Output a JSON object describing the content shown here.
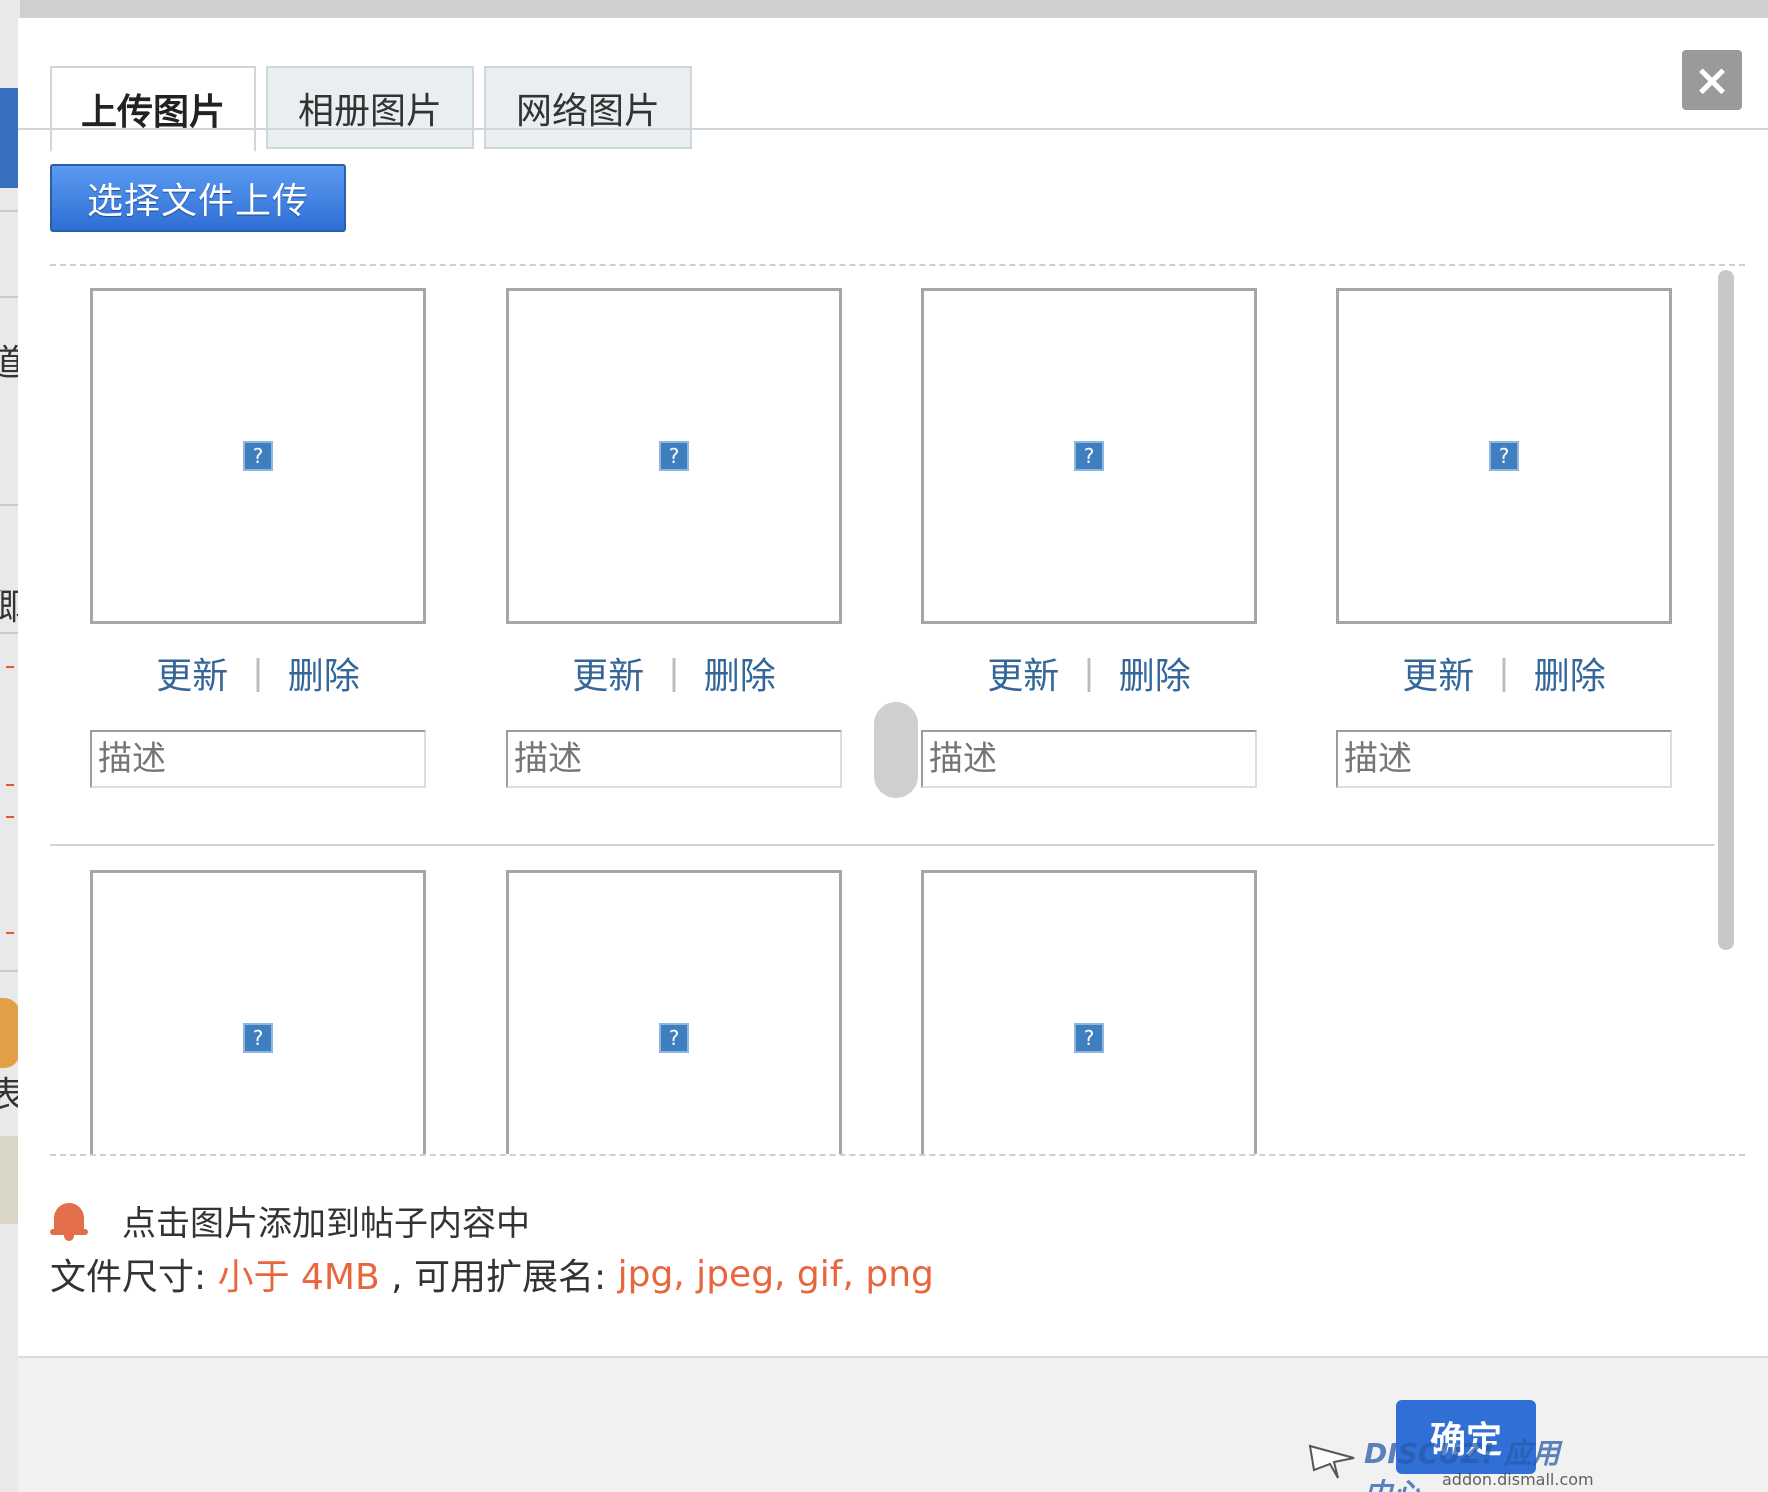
{
  "tabs": [
    {
      "label": "上传图片",
      "active": true
    },
    {
      "label": "相册图片",
      "active": false
    },
    {
      "label": "网络图片",
      "active": false
    }
  ],
  "close_icon": "×",
  "upload_button": "选择文件上传",
  "image_cells": [
    {
      "placeholder_icon": "?",
      "update": "更新",
      "delete": "删除",
      "separator": "|",
      "desc_placeholder": "描述"
    },
    {
      "placeholder_icon": "?",
      "update": "更新",
      "delete": "删除",
      "separator": "|",
      "desc_placeholder": "描述"
    },
    {
      "placeholder_icon": "?",
      "update": "更新",
      "delete": "删除",
      "separator": "|",
      "desc_placeholder": "描述"
    },
    {
      "placeholder_icon": "?",
      "update": "更新",
      "delete": "删除",
      "separator": "|",
      "desc_placeholder": "描述"
    },
    {
      "placeholder_icon": "?"
    },
    {
      "placeholder_icon": "?"
    },
    {
      "placeholder_icon": "?"
    }
  ],
  "tip": "点击图片添加到帖子内容中",
  "rules": {
    "size_label": "文件尺寸: ",
    "size_value": "小于 4MB",
    "ext_label": " , 可用扩展名: ",
    "ext_value": "jpg, jpeg, gif, png"
  },
  "confirm_button": "确定",
  "watermark": {
    "brand": "DISCUZ! 应用中心",
    "url": "addon.dismall.com"
  },
  "colors": {
    "accent": "#2f6fd6",
    "highlight": "#e8663e",
    "link": "#336699"
  }
}
